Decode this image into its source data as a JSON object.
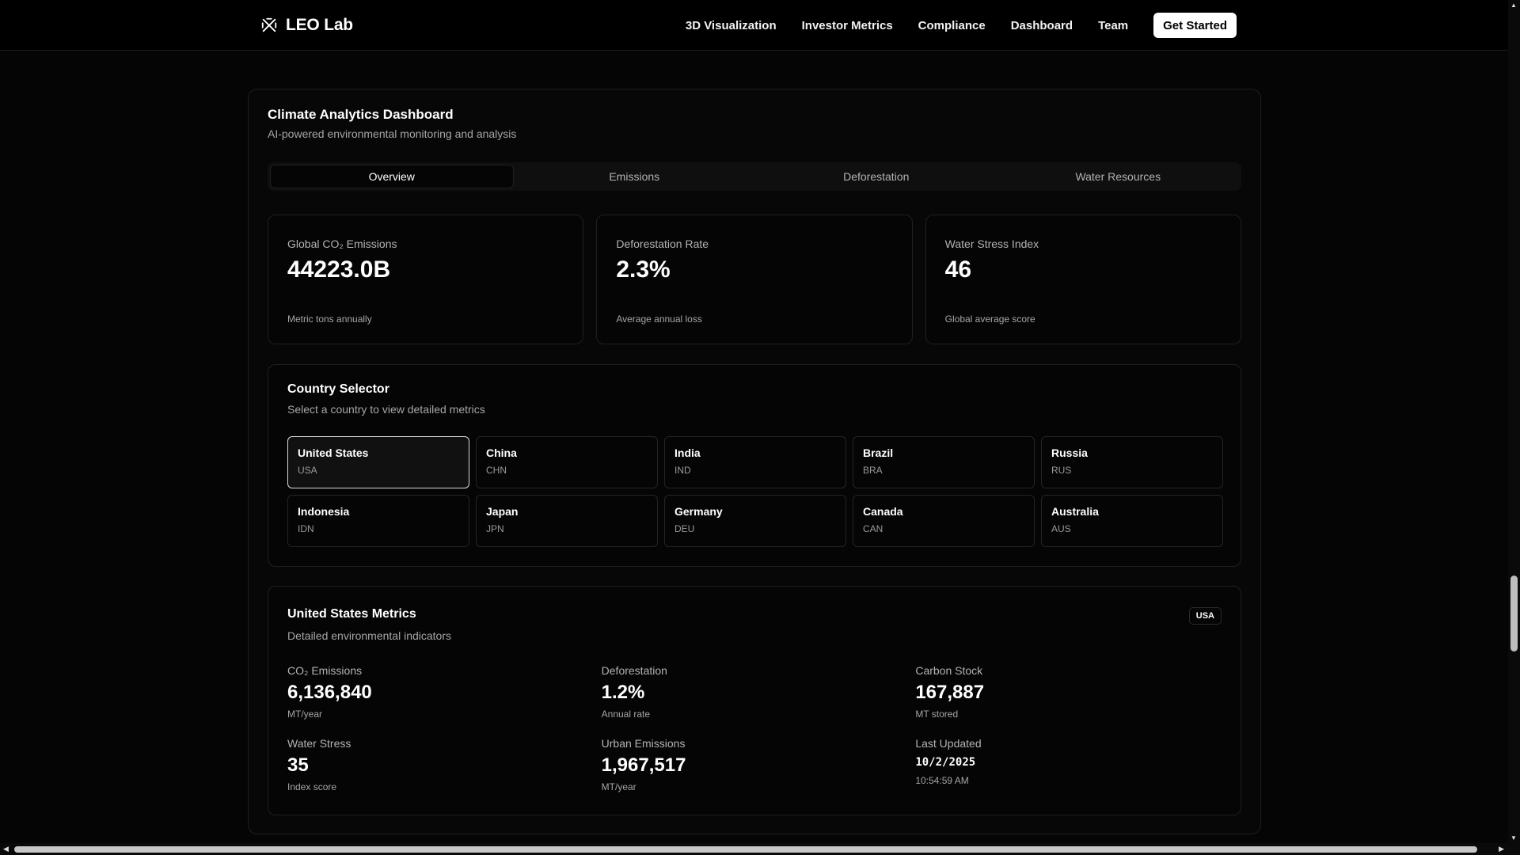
{
  "nav": {
    "brand": "LEO Lab",
    "links": [
      "3D Visualization",
      "Investor Metrics",
      "Compliance",
      "Dashboard",
      "Team"
    ],
    "cta": "Get Started"
  },
  "dashboard": {
    "title": "Climate Analytics Dashboard",
    "subtitle": "AI-powered environmental monitoring and analysis",
    "tabs": [
      "Overview",
      "Emissions",
      "Deforestation",
      "Water Resources"
    ],
    "active_tab": "Overview"
  },
  "stats": [
    {
      "label": "Global CO₂ Emissions",
      "value": "44223.0B",
      "note": "Metric tons annually"
    },
    {
      "label": "Deforestation Rate",
      "value": "2.3%",
      "note": "Average annual loss"
    },
    {
      "label": "Water Stress Index",
      "value": "46",
      "note": "Global average score"
    }
  ],
  "selector": {
    "title": "Country Selector",
    "subtitle": "Select a country to view detailed metrics",
    "countries": [
      {
        "name": "United States",
        "code": "USA"
      },
      {
        "name": "China",
        "code": "CHN"
      },
      {
        "name": "India",
        "code": "IND"
      },
      {
        "name": "Brazil",
        "code": "BRA"
      },
      {
        "name": "Russia",
        "code": "RUS"
      },
      {
        "name": "Indonesia",
        "code": "IDN"
      },
      {
        "name": "Japan",
        "code": "JPN"
      },
      {
        "name": "Germany",
        "code": "DEU"
      },
      {
        "name": "Canada",
        "code": "CAN"
      },
      {
        "name": "Australia",
        "code": "AUS"
      }
    ],
    "selected": "USA"
  },
  "metrics": {
    "title": "United States Metrics",
    "subtitle": "Detailed environmental indicators",
    "badge": "USA",
    "items": [
      {
        "label": "CO₂ Emissions",
        "value": "6,136,840",
        "note": "MT/year"
      },
      {
        "label": "Deforestation",
        "value": "1.2%",
        "note": "Annual rate"
      },
      {
        "label": "Carbon Stock",
        "value": "167,887",
        "note": "MT stored"
      },
      {
        "label": "Water Stress",
        "value": "35",
        "note": "Index score"
      },
      {
        "label": "Urban Emissions",
        "value": "1,967,517",
        "note": "MT/year"
      }
    ],
    "last_updated": {
      "label": "Last Updated",
      "date": "10/2/2025",
      "time": "10:54:59 AM"
    }
  }
}
